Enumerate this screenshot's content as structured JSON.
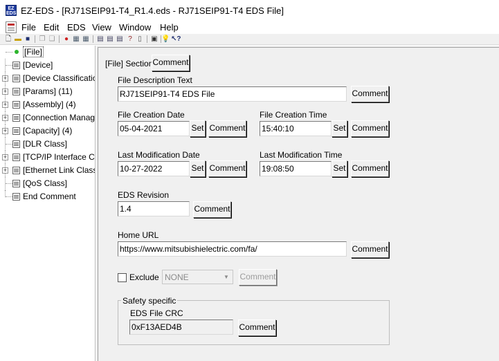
{
  "window": {
    "title": "EZ-EDS - [RJ71SEIP91-T4_R1.4.eds - RJ71SEIP91-T4 EDS File]",
    "logo_top": "EZ",
    "logo_bottom": "EDS"
  },
  "menu": {
    "items": [
      "File",
      "Edit",
      "EDS",
      "View",
      "Window",
      "Help"
    ]
  },
  "toolbar": {
    "buttons": [
      "new-icon",
      "open-icon",
      "save-icon",
      "copy-icon",
      "paste-icon",
      "stop-icon",
      "import-icon",
      "export-icon",
      "tool1-icon",
      "tool2-icon",
      "tool3-icon",
      "help-book-icon",
      "print-icon",
      "hint-icon",
      "context-help-icon"
    ]
  },
  "tree": {
    "items": [
      {
        "label": "[File]",
        "expandable": false,
        "selected": true
      },
      {
        "label": "[Device]",
        "expandable": false
      },
      {
        "label": "[Device Classification]",
        "expandable": true
      },
      {
        "label": "[Params] (11)",
        "expandable": true
      },
      {
        "label": "[Assembly] (4)",
        "expandable": true
      },
      {
        "label": "[Connection Manager]",
        "expandable": true
      },
      {
        "label": "[Capacity] (4)",
        "expandable": true
      },
      {
        "label": "[DLR Class]",
        "expandable": false
      },
      {
        "label": "[TCP/IP Interface Class]",
        "expandable": true
      },
      {
        "label": "[Ethernet Link Class]",
        "expandable": true
      },
      {
        "label": "[QoS Class]",
        "expandable": false
      },
      {
        "label": "End Comment",
        "expandable": false
      }
    ]
  },
  "form": {
    "section_label": "[File] Section",
    "comment_label": "Comment",
    "set_label": "Set",
    "file_description": {
      "label": "File Description Text",
      "value": "RJ71SEIP91-T4 EDS File"
    },
    "creation_date": {
      "label": "File Creation Date",
      "value": "05-04-2021"
    },
    "creation_time": {
      "label": "File Creation Time",
      "value": "15:40:10"
    },
    "mod_date": {
      "label": "Last Modification Date",
      "value": "10-27-2022"
    },
    "mod_time": {
      "label": "Last Modification Time",
      "value": "19:08:50"
    },
    "eds_revision": {
      "label": "EDS Revision",
      "value": "1.4"
    },
    "home_url": {
      "label": "Home URL",
      "value": "https://www.mitsubishielectric.com/fa/"
    },
    "exclude": {
      "label": "Exclude",
      "checked": false,
      "selected_option": "NONE"
    },
    "safety": {
      "group_title": "Safety specific",
      "crc_label": "EDS File CRC",
      "crc_value": "0xF13AED4B"
    }
  }
}
